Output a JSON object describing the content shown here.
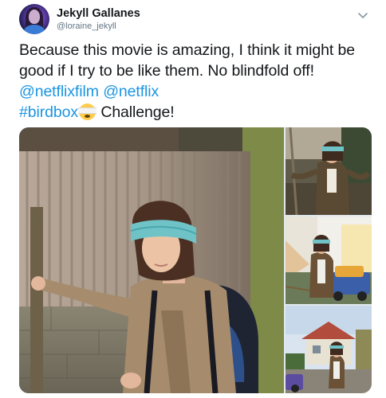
{
  "author": {
    "display_name": "Jekyll Gallanes",
    "handle": "@loraine_jekyll"
  },
  "tweet": {
    "text_part1": "Because this movie is amazing, I think it might be good if I try to be like them. No blindfold off! ",
    "mention_1": "@netflixfilm",
    "space_1": " ",
    "mention_2": "@netflix",
    "line_break_text": " ",
    "hashtag": "#birdbox",
    "emoji_name": "face-with-head-bandage-emoji",
    "text_part2": " Challenge!"
  },
  "media": {
    "main_image": "photo-blindfolded-girl-with-backpack-by-tin-wall",
    "side_images": [
      "photo-blindfolded-girl-in-yard",
      "photo-blindfolded-girl-by-colorful-tricycle",
      "photo-blindfolded-girl-walking-on-street"
    ]
  },
  "colors": {
    "link": "#1b95e0",
    "text": "#14171a",
    "secondary": "#657786"
  },
  "icons": {
    "menu": "chevron-down-icon"
  }
}
